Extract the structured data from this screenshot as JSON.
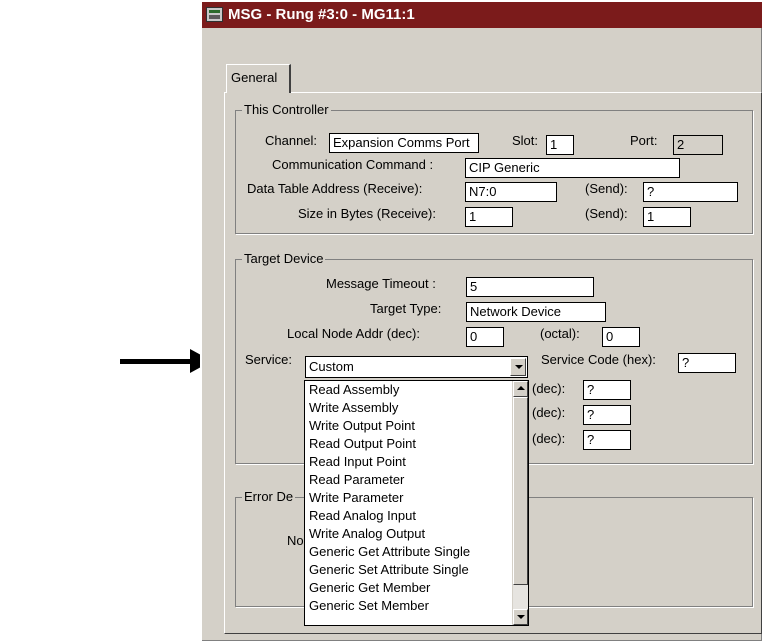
{
  "window": {
    "title": "MSG - Rung #3:0 - MG11:1"
  },
  "tabs": [
    {
      "label": "General"
    }
  ],
  "this_controller": {
    "legend": "This Controller",
    "channel_label": "Channel:",
    "channel_value": "Expansion Comms Port",
    "slot_label": "Slot:",
    "slot_value": "1",
    "port_label": "Port:",
    "port_value": "2",
    "command_label": "Communication Command :",
    "command_value": "CIP Generic",
    "dta_receive_label": "Data Table Address (Receive):",
    "dta_receive_value": "N7:0",
    "dta_send_label": "(Send):",
    "dta_send_value": "?",
    "size_receive_label": "Size in Bytes (Receive):",
    "size_receive_value": "1",
    "size_send_label": "(Send):",
    "size_send_value": "1"
  },
  "target_device": {
    "legend": "Target Device",
    "timeout_label": "Message Timeout :",
    "timeout_value": "5",
    "target_type_label": "Target Type:",
    "target_type_value": "Network Device",
    "local_node_label": "Local Node Addr (dec):",
    "local_node_value": "0",
    "octal_label": "(octal):",
    "octal_value": "0",
    "service_label": "Service:",
    "service_value": "Custom",
    "service_code_label": "Service Code (hex):",
    "service_code_value": "?",
    "dec_label": "(dec):",
    "dec_values": [
      "?",
      "?",
      "?"
    ]
  },
  "service_dropdown": {
    "options": [
      "Read Assembly",
      "Write Assembly",
      "Write Output Point",
      "Read Output Point",
      "Read Input Point",
      "Read Parameter",
      "Write Parameter",
      "Read Analog Input",
      "Write Analog Output",
      "Generic Get Attribute Single",
      "Generic Set Attribute Single",
      "Generic Get Member",
      "Generic Set Member"
    ]
  },
  "error": {
    "legend_partial": "Error De",
    "row_partial": "No"
  }
}
